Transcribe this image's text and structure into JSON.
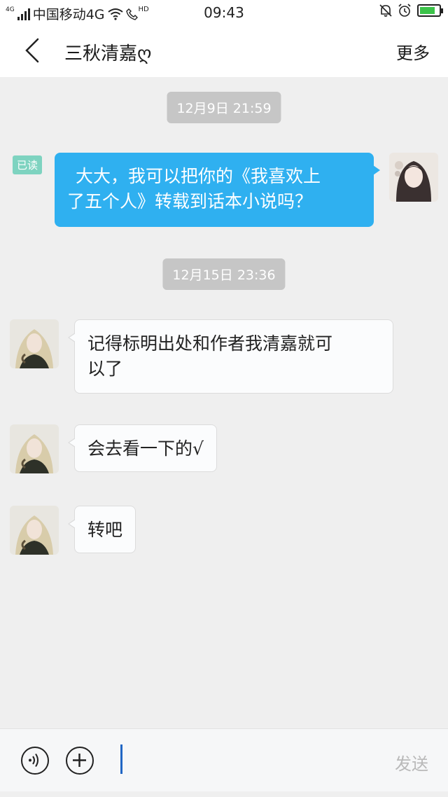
{
  "status_bar": {
    "network_small": "4G",
    "carrier": "中国移动4G",
    "hd_label": "HD",
    "time": "09:43",
    "battery_level": 0.8,
    "battery_color": "#3cc34a"
  },
  "header": {
    "back_icon": "chevron-left-icon",
    "title": "三秋清嘉ღ",
    "more_label": "更多"
  },
  "messages": [
    {
      "type": "timestamp",
      "text": "12月9日 21:59"
    },
    {
      "type": "outgoing",
      "read_label": "已读",
      "text_line1": "大大，我可以把你的《我喜欢上",
      "text_line2": "了五个人》转载到话本小说吗？"
    },
    {
      "type": "timestamp",
      "text": "12月15日 23:36"
    },
    {
      "type": "incoming",
      "text_line1": "记得标明出处和作者我清嘉就可",
      "text_line2": "以了"
    },
    {
      "type": "incoming",
      "text": "会去看一下的√"
    },
    {
      "type": "incoming",
      "text": "转吧"
    }
  ],
  "input_bar": {
    "voice_icon": "voice-icon",
    "plus_icon": "plus-icon",
    "input_value": "",
    "send_label": "发送"
  },
  "colors": {
    "outgoing_bubble": "#2fb0f0",
    "incoming_bubble": "#fbfcfd",
    "timestamp_bg": "#c6c6c6",
    "read_badge": "#7ed3c0",
    "chat_bg": "#efefef"
  }
}
